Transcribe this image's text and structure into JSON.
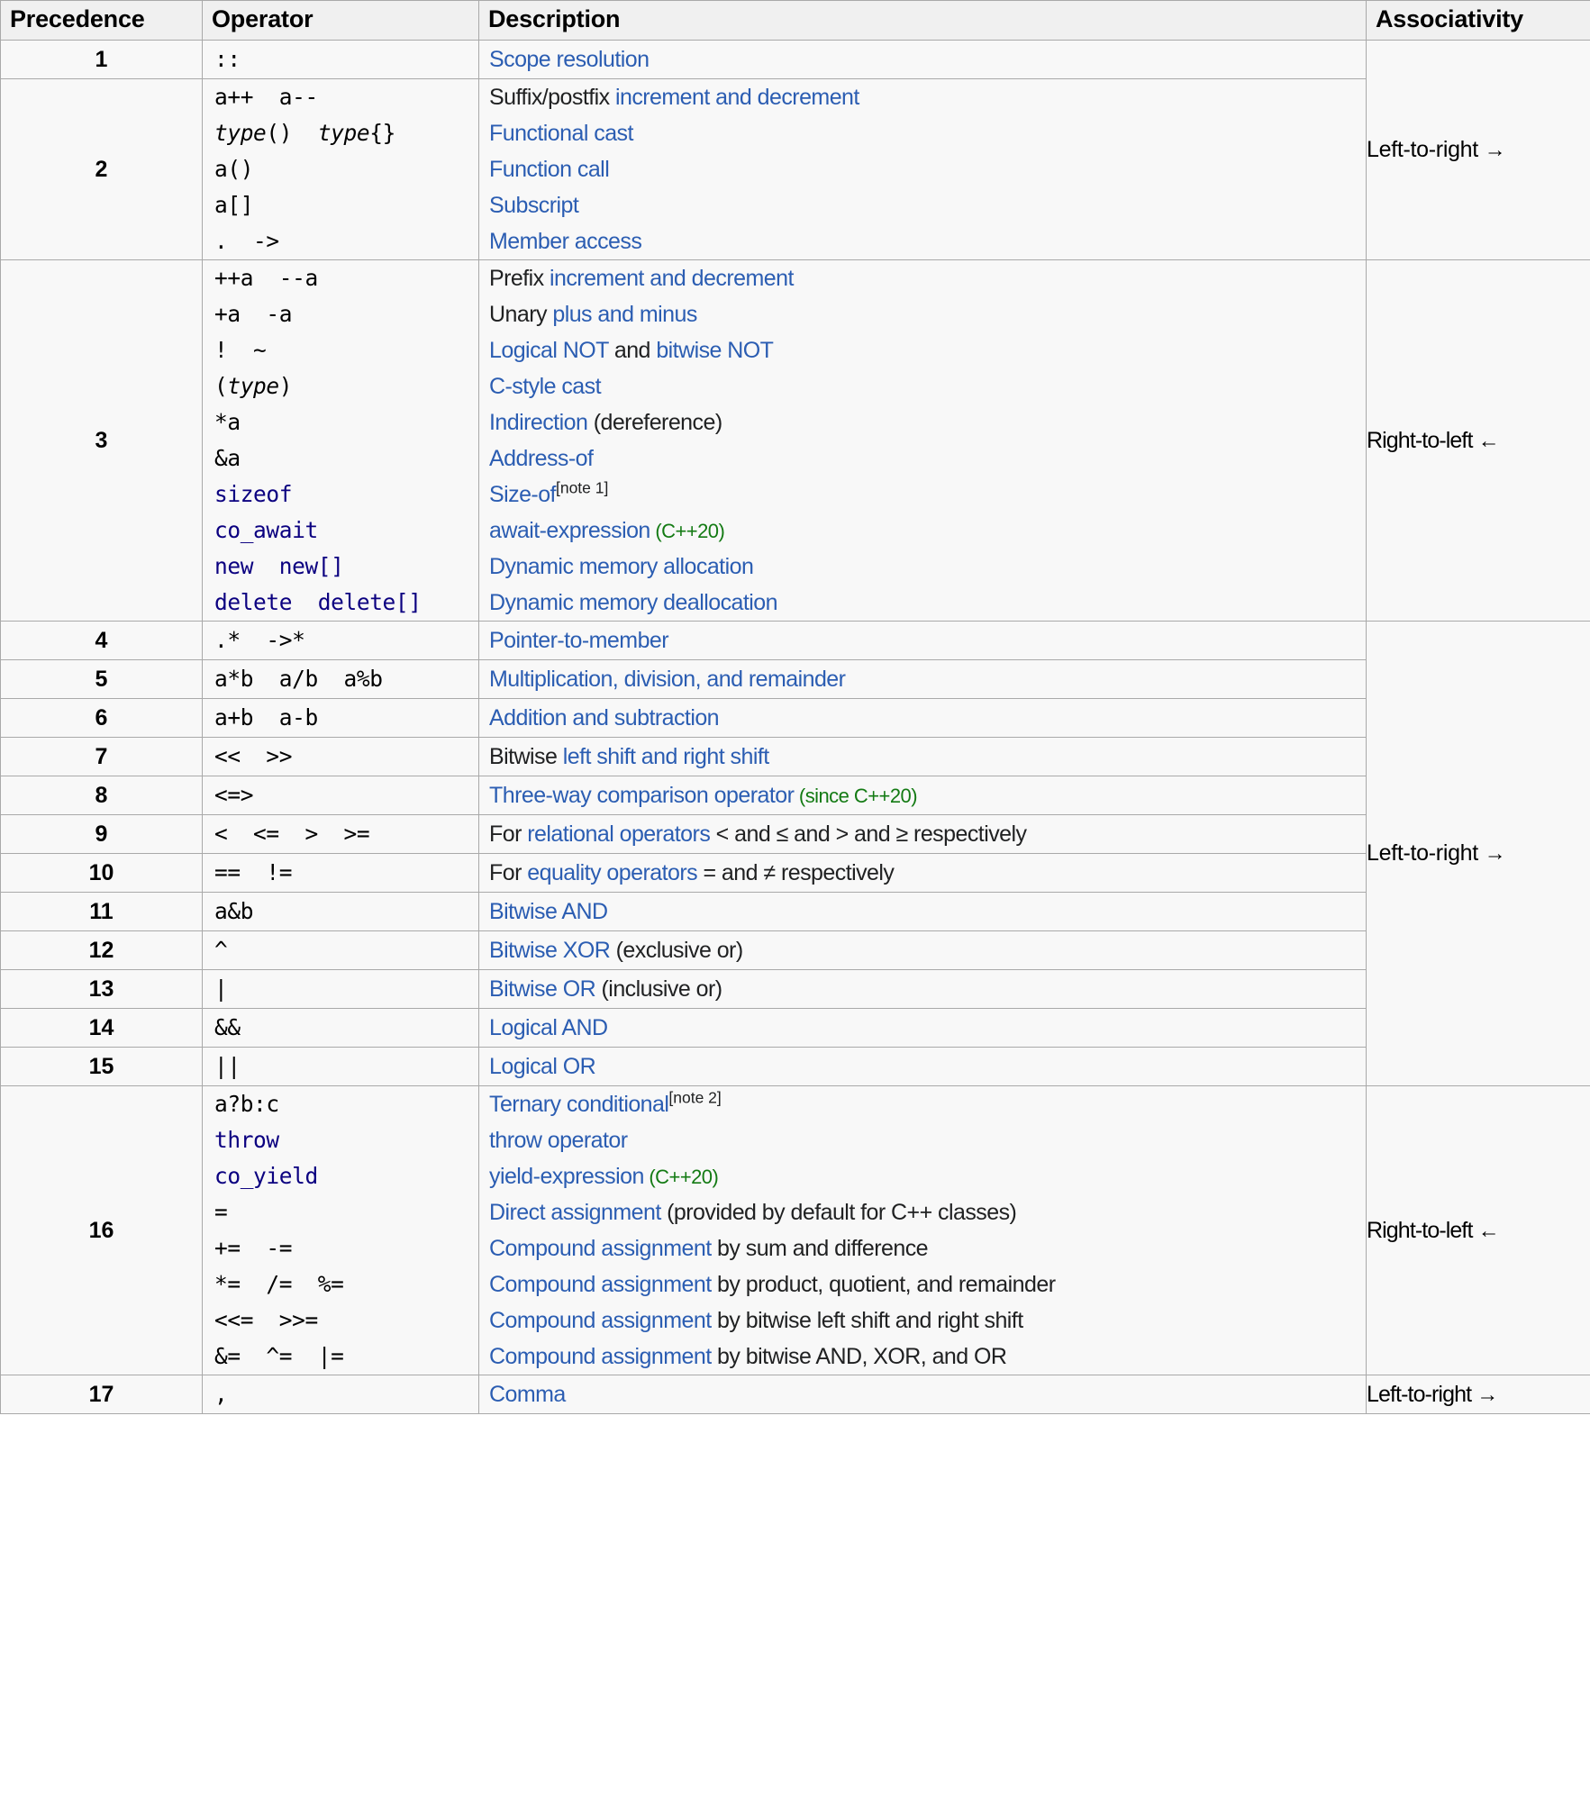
{
  "table": {
    "headers": {
      "precedence": "Precedence",
      "operator": "Operator",
      "description": "Description",
      "associativity": "Associativity"
    },
    "colors": {
      "link": "#2b5db2",
      "keyword": "#0b0080",
      "version": "#137a13",
      "border": "#a9a9a9",
      "cell_bg": "#f8f8f8",
      "header_bg": "#f0f0f0"
    },
    "associativity_groups": [
      {
        "label": "Left-to-right",
        "arrow": "→",
        "applies_to": [
          1,
          2
        ]
      },
      {
        "label": "Right-to-left",
        "arrow": "←",
        "applies_to": [
          3
        ]
      },
      {
        "label": "Left-to-right",
        "arrow": "→",
        "applies_to": [
          4,
          5,
          6,
          7,
          8,
          9,
          10,
          11,
          12,
          13,
          14,
          15
        ]
      },
      {
        "label": "Right-to-left",
        "arrow": "←",
        "applies_to": [
          16
        ]
      },
      {
        "label": "Left-to-right",
        "arrow": "→",
        "applies_to": [
          17
        ]
      }
    ],
    "rows": [
      {
        "precedence": "1",
        "operators": [
          {
            "text": "::"
          }
        ],
        "descriptions": [
          {
            "parts": [
              {
                "t": "Scope resolution",
                "s": "link"
              }
            ]
          }
        ]
      },
      {
        "precedence": "2",
        "operators": [
          {
            "text": "a++  a--"
          },
          {
            "text": "type()  type{}",
            "style": "italic-type"
          },
          {
            "text": "a()"
          },
          {
            "text": "a[]"
          },
          {
            "text": ".  ->"
          }
        ],
        "descriptions": [
          {
            "parts": [
              {
                "t": "Suffix/postfix ",
                "s": "plain"
              },
              {
                "t": "increment and decrement",
                "s": "link"
              }
            ]
          },
          {
            "parts": [
              {
                "t": "Functional cast",
                "s": "link"
              }
            ]
          },
          {
            "parts": [
              {
                "t": "Function call",
                "s": "link"
              }
            ]
          },
          {
            "parts": [
              {
                "t": "Subscript",
                "s": "link"
              }
            ]
          },
          {
            "parts": [
              {
                "t": "Member access",
                "s": "link"
              }
            ]
          }
        ]
      },
      {
        "precedence": "3",
        "operators": [
          {
            "text": "++a  --a"
          },
          {
            "text": "+a  -a"
          },
          {
            "text": "!  ~"
          },
          {
            "text": "(type)",
            "style": "italic-type"
          },
          {
            "text": "*a"
          },
          {
            "text": "&a"
          },
          {
            "text": "sizeof",
            "style": "keyword"
          },
          {
            "text": "co_await",
            "style": "keyword"
          },
          {
            "text": "new  new[]",
            "style": "keyword"
          },
          {
            "text": "delete  delete[]",
            "style": "keyword"
          }
        ],
        "descriptions": [
          {
            "parts": [
              {
                "t": "Prefix ",
                "s": "plain"
              },
              {
                "t": "increment and decrement",
                "s": "link"
              }
            ]
          },
          {
            "parts": [
              {
                "t": "Unary ",
                "s": "plain"
              },
              {
                "t": "plus and minus",
                "s": "link"
              }
            ]
          },
          {
            "parts": [
              {
                "t": "Logical NOT",
                "s": "link"
              },
              {
                "t": " and ",
                "s": "plain"
              },
              {
                "t": "bitwise NOT",
                "s": "link"
              }
            ]
          },
          {
            "parts": [
              {
                "t": "C-style cast",
                "s": "link"
              }
            ]
          },
          {
            "parts": [
              {
                "t": "Indirection",
                "s": "link"
              },
              {
                "t": " (dereference)",
                "s": "plain"
              }
            ]
          },
          {
            "parts": [
              {
                "t": "Address-of",
                "s": "link"
              }
            ]
          },
          {
            "parts": [
              {
                "t": "Size-of",
                "s": "link"
              },
              {
                "t": "[note 1]",
                "s": "note"
              }
            ]
          },
          {
            "parts": [
              {
                "t": "await-expression",
                "s": "link"
              },
              {
                "t": " (C++20)",
                "s": "version"
              }
            ]
          },
          {
            "parts": [
              {
                "t": "Dynamic memory allocation",
                "s": "link"
              }
            ]
          },
          {
            "parts": [
              {
                "t": "Dynamic memory deallocation",
                "s": "link"
              }
            ]
          }
        ]
      },
      {
        "precedence": "4",
        "operators": [
          {
            "text": ".*  ->*"
          }
        ],
        "descriptions": [
          {
            "parts": [
              {
                "t": "Pointer-to-member",
                "s": "link"
              }
            ]
          }
        ]
      },
      {
        "precedence": "5",
        "operators": [
          {
            "text": "a*b  a/b  a%b"
          }
        ],
        "descriptions": [
          {
            "parts": [
              {
                "t": "Multiplication, division, and remainder",
                "s": "link"
              }
            ]
          }
        ]
      },
      {
        "precedence": "6",
        "operators": [
          {
            "text": "a+b  a-b"
          }
        ],
        "descriptions": [
          {
            "parts": [
              {
                "t": "Addition and subtraction",
                "s": "link"
              }
            ]
          }
        ]
      },
      {
        "precedence": "7",
        "operators": [
          {
            "text": "<<  >>"
          }
        ],
        "descriptions": [
          {
            "parts": [
              {
                "t": "Bitwise ",
                "s": "plain"
              },
              {
                "t": "left shift and right shift",
                "s": "link"
              }
            ]
          }
        ]
      },
      {
        "precedence": "8",
        "operators": [
          {
            "text": "<=>"
          }
        ],
        "descriptions": [
          {
            "parts": [
              {
                "t": "Three-way comparison operator",
                "s": "link"
              },
              {
                "t": " (since C++20)",
                "s": "version"
              }
            ]
          }
        ]
      },
      {
        "precedence": "9",
        "operators": [
          {
            "text": "<  <=  >  >="
          }
        ],
        "descriptions": [
          {
            "parts": [
              {
                "t": "For ",
                "s": "plain"
              },
              {
                "t": "relational operators",
                "s": "link"
              },
              {
                "t": " < and ≤ and > and ≥ respectively",
                "s": "plain"
              }
            ]
          }
        ]
      },
      {
        "precedence": "10",
        "operators": [
          {
            "text": "==  !="
          }
        ],
        "descriptions": [
          {
            "parts": [
              {
                "t": "For ",
                "s": "plain"
              },
              {
                "t": "equality operators",
                "s": "link"
              },
              {
                "t": " = and ≠ respectively",
                "s": "plain"
              }
            ]
          }
        ]
      },
      {
        "precedence": "11",
        "operators": [
          {
            "text": "a&b"
          }
        ],
        "descriptions": [
          {
            "parts": [
              {
                "t": "Bitwise AND",
                "s": "link"
              }
            ]
          }
        ]
      },
      {
        "precedence": "12",
        "operators": [
          {
            "text": "^"
          }
        ],
        "descriptions": [
          {
            "parts": [
              {
                "t": "Bitwise XOR",
                "s": "link"
              },
              {
                "t": " (exclusive or)",
                "s": "plain"
              }
            ]
          }
        ]
      },
      {
        "precedence": "13",
        "operators": [
          {
            "text": "|"
          }
        ],
        "descriptions": [
          {
            "parts": [
              {
                "t": "Bitwise OR",
                "s": "link"
              },
              {
                "t": " (inclusive or)",
                "s": "plain"
              }
            ]
          }
        ]
      },
      {
        "precedence": "14",
        "operators": [
          {
            "text": "&&"
          }
        ],
        "descriptions": [
          {
            "parts": [
              {
                "t": "Logical AND",
                "s": "link"
              }
            ]
          }
        ]
      },
      {
        "precedence": "15",
        "operators": [
          {
            "text": "||"
          }
        ],
        "descriptions": [
          {
            "parts": [
              {
                "t": "Logical OR",
                "s": "link"
              }
            ]
          }
        ]
      },
      {
        "precedence": "16",
        "operators": [
          {
            "text": "a?b:c"
          },
          {
            "text": "throw",
            "style": "keyword"
          },
          {
            "text": "co_yield",
            "style": "keyword"
          },
          {
            "text": "="
          },
          {
            "text": "+=  -="
          },
          {
            "text": "*=  /=  %="
          },
          {
            "text": "<<=  >>="
          },
          {
            "text": "&=  ^=  |="
          }
        ],
        "descriptions": [
          {
            "parts": [
              {
                "t": "Ternary conditional",
                "s": "link"
              },
              {
                "t": "[note 2]",
                "s": "note"
              }
            ]
          },
          {
            "parts": [
              {
                "t": "throw operator",
                "s": "link"
              }
            ]
          },
          {
            "parts": [
              {
                "t": "yield-expression",
                "s": "link"
              },
              {
                "t": " (C++20)",
                "s": "version"
              }
            ]
          },
          {
            "parts": [
              {
                "t": "Direct assignment",
                "s": "link"
              },
              {
                "t": " (provided by default for C++ classes)",
                "s": "plain"
              }
            ]
          },
          {
            "parts": [
              {
                "t": "Compound assignment",
                "s": "link"
              },
              {
                "t": " by sum and difference",
                "s": "plain"
              }
            ]
          },
          {
            "parts": [
              {
                "t": "Compound assignment",
                "s": "link"
              },
              {
                "t": " by product, quotient, and remainder",
                "s": "plain"
              }
            ]
          },
          {
            "parts": [
              {
                "t": "Compound assignment",
                "s": "link"
              },
              {
                "t": " by bitwise left shift and right shift",
                "s": "plain"
              }
            ]
          },
          {
            "parts": [
              {
                "t": "Compound assignment",
                "s": "link"
              },
              {
                "t": " by bitwise AND, XOR, and OR",
                "s": "plain"
              }
            ]
          }
        ]
      },
      {
        "precedence": "17",
        "operators": [
          {
            "text": ","
          }
        ],
        "descriptions": [
          {
            "parts": [
              {
                "t": "Comma",
                "s": "link"
              }
            ]
          }
        ]
      }
    ]
  }
}
